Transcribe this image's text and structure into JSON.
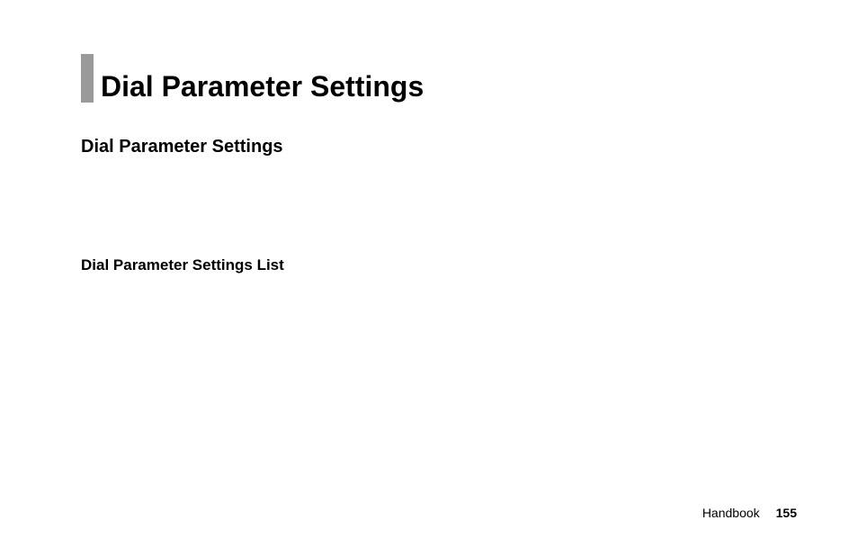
{
  "heading": {
    "title": "Dial Parameter Settings"
  },
  "sections": {
    "first": "Dial Parameter Settings",
    "second": "Dial Parameter Settings List"
  },
  "footer": {
    "label": "Handbook",
    "page_number": "155"
  }
}
